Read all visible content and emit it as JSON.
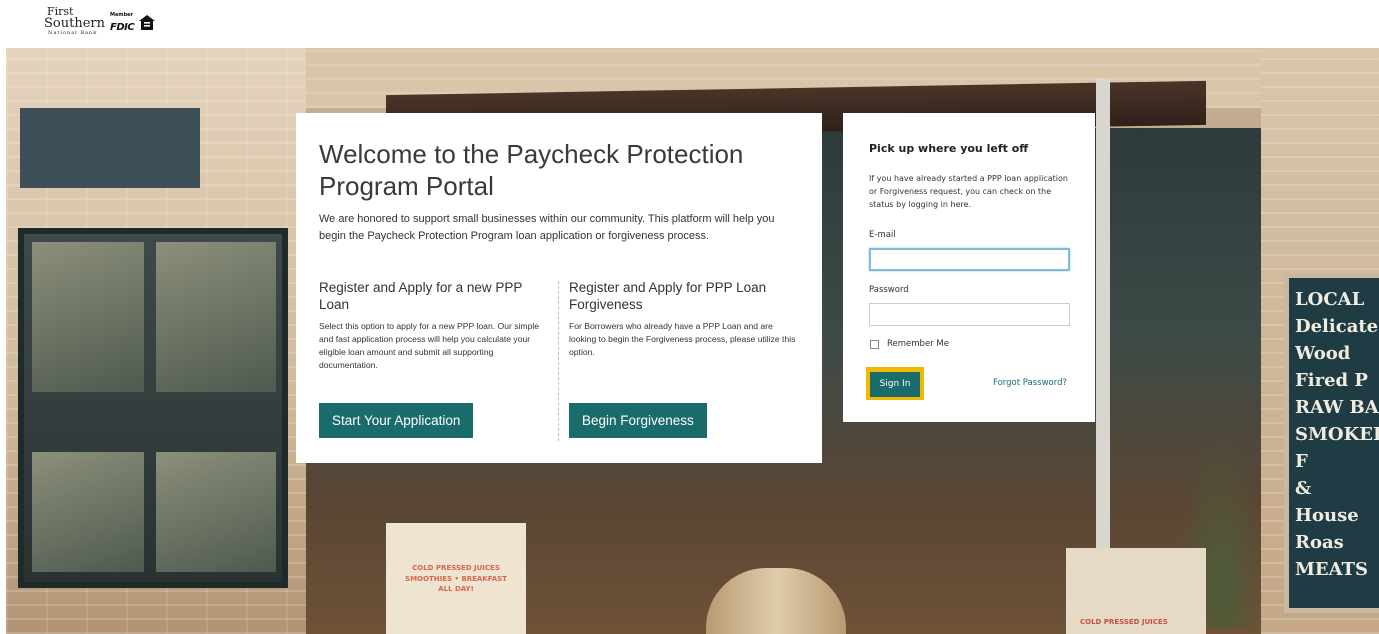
{
  "header": {
    "logo": {
      "line1": "First",
      "line2": "Southern",
      "line3": "National Bank"
    },
    "fdic": {
      "member": "Member",
      "text": "FDIC"
    }
  },
  "hero": {
    "chalkboard": [
      "LOCAL",
      "Delicatess",
      "Wood Fired P",
      "RAW BA",
      "SMOKED F",
      "&",
      "House Roas",
      "MEATS"
    ],
    "sign_left": [
      "COLD PRESSED JUICES",
      "SMOOTHIES • BREAKFAST",
      "ALL DAY!"
    ],
    "sign_right": "COLD PRESSED JUICES"
  },
  "welcome": {
    "title": "Welcome to the Paycheck Protection Program Portal",
    "intro": "We are honored to support small businesses within our community. This platform will help you begin the Paycheck Protection Program loan application or forgiveness process.",
    "left": {
      "heading": "Register and Apply for a new PPP Loan",
      "text": "Select this option to apply for a new PPP loan. Our simple and fast application process will help you calculate your eligible loan amount and submit all supporting documentation.",
      "button": "Start Your Application"
    },
    "right": {
      "heading": "Register and Apply for PPP Loan Forgiveness",
      "text": "For Borrowers who already have a PPP Loan and are looking to begin the Forgiveness process, please utilize this option.",
      "button": "Begin Forgiveness"
    }
  },
  "login": {
    "title": "Pick up where you left off",
    "intro": "If you have already started a PPP loan application or Forgiveness request, you can check on the status by logging in here.",
    "email_label": "E-mail",
    "email_value": "",
    "password_label": "Password",
    "password_value": "",
    "remember_label": "Remember Me",
    "remember_checked": false,
    "signin_label": "Sign In",
    "forgot_label": "Forgot Password?"
  },
  "colors": {
    "teal": "#1a6b6b",
    "highlight": "#f2b800",
    "focus": "#7fbcd8"
  }
}
